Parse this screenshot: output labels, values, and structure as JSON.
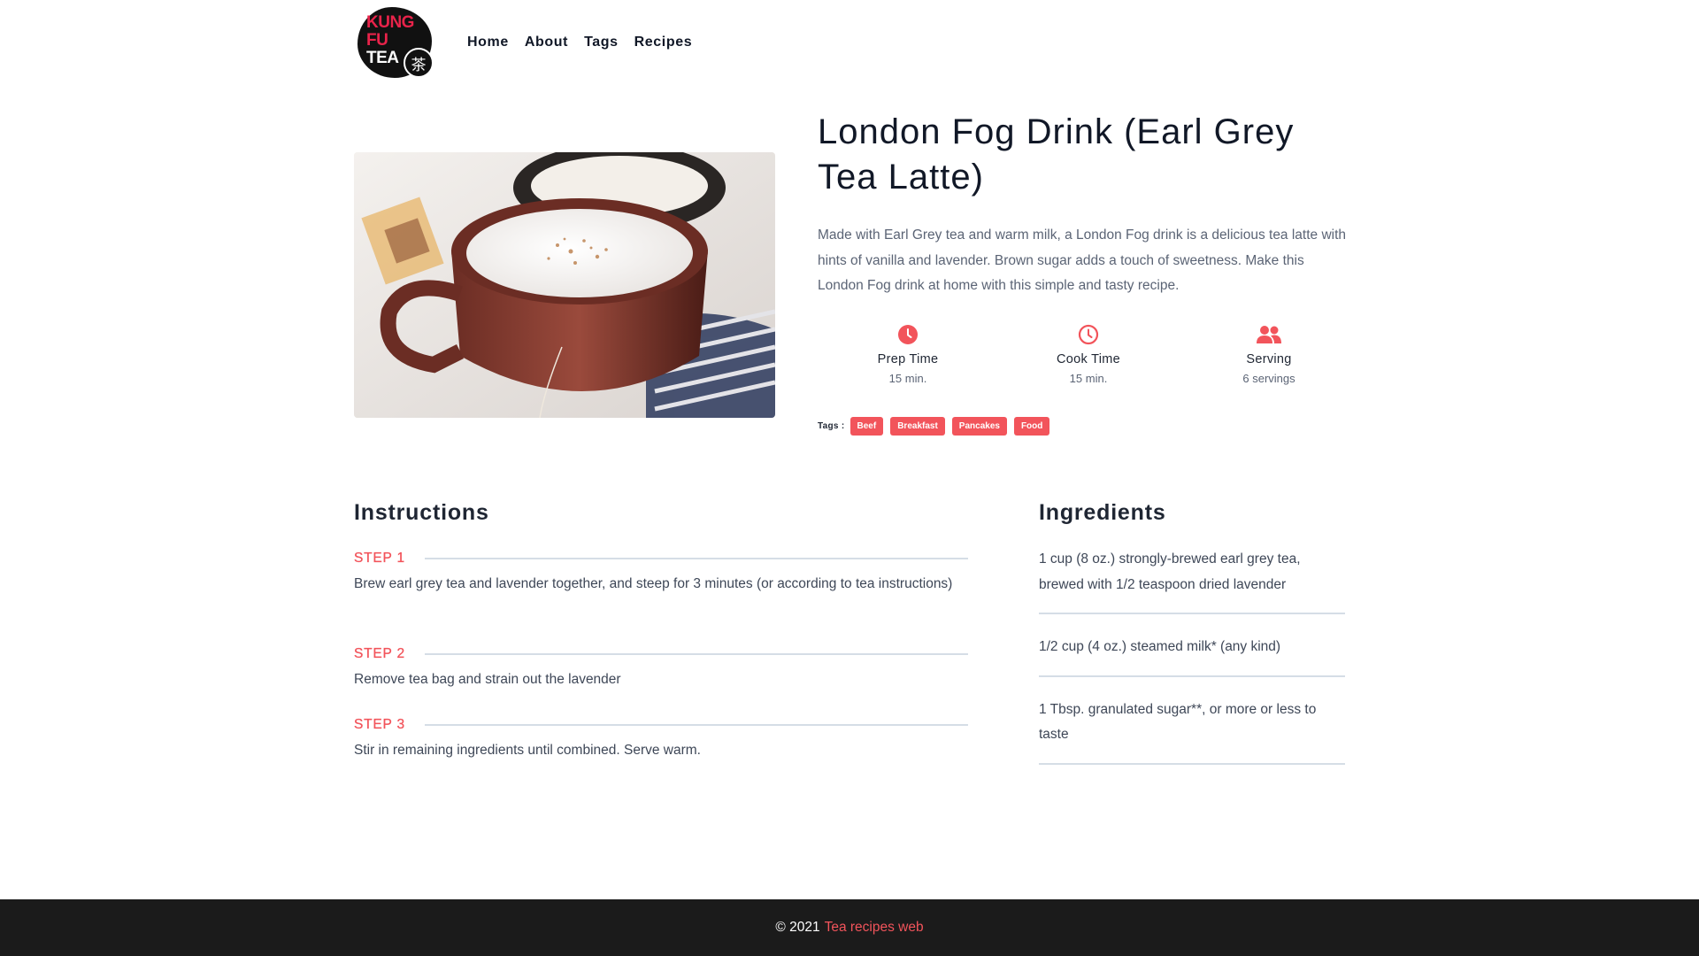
{
  "brand": {
    "logo_line1": "KUNG",
    "logo_line2": "FU",
    "logo_line3": "TEA",
    "logo_seal": "茶",
    "colors": {
      "accent": "#f2545b",
      "logo_red": "#e8234a",
      "logo_black": "#111111"
    }
  },
  "nav": {
    "items": [
      {
        "label": "Home"
      },
      {
        "label": "About"
      },
      {
        "label": "Tags"
      },
      {
        "label": "Recipes"
      }
    ]
  },
  "recipe": {
    "image_icon": "latte-photo",
    "title": "London Fog Drink (Earl Grey Tea Latte)",
    "description": "Made with Earl Grey tea and warm milk, a London Fog drink is a delicious tea latte with hints of vanilla and lavender. Brown sugar adds a touch of sweetness. Make this London Fog drink at home with this simple and tasty recipe.",
    "stats": [
      {
        "icon": "clock-solid-icon",
        "label": "Prep Time",
        "value": "15 min."
      },
      {
        "icon": "clock-outline-icon",
        "label": "Cook Time",
        "value": "15 min."
      },
      {
        "icon": "users-icon",
        "label": "Serving",
        "value": "6 servings"
      }
    ],
    "tags_label": "Tags :",
    "tags": [
      "Beef",
      "Breakfast",
      "Pancakes",
      "Food"
    ]
  },
  "instructions": {
    "title": "Instructions",
    "steps": [
      {
        "label": "STEP 1",
        "text": "Brew earl grey tea and lavender together, and steep for 3 minutes (or according to tea instructions)"
      },
      {
        "label": "STEP 2",
        "text": "Remove tea bag and strain out the lavender"
      },
      {
        "label": "STEP 3",
        "text": "Stir in remaining ingredients until combined. Serve warm."
      }
    ]
  },
  "ingredients": {
    "title": "Ingredients",
    "items": [
      "1 cup (8 oz.) strongly-brewed earl grey tea, brewed with 1/2 teaspoon dried lavender",
      "1/2 cup (4 oz.) steamed milk* (any kind)",
      "1 Tbsp. granulated sugar**, or more or less to taste"
    ]
  },
  "footer": {
    "copyright": "© 2021",
    "link": "Tea recipes web"
  }
}
